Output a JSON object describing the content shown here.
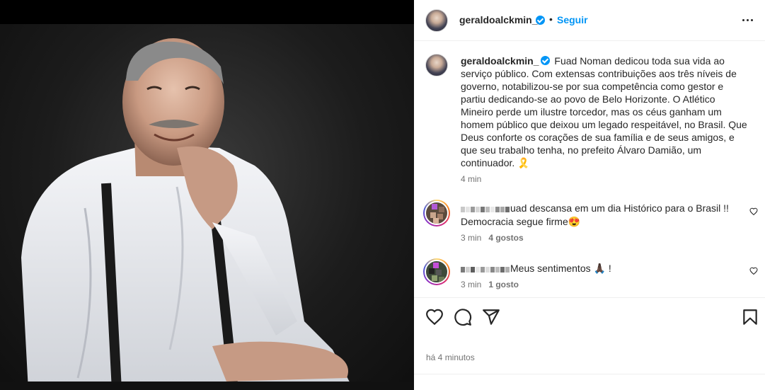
{
  "post": {
    "username": "geraldoalckmin_",
    "follow_label": "Seguir",
    "separator": "•",
    "caption": "Fuad Noman dedicou toda sua vida ao serviço público. Com extensas contribuições aos três níveis de governo, notabilizou-se por sua competência como gestor e partiu dedicando-se ao povo de Belo Horizonte. O Atlético Mineiro perde um ilustre torcedor, mas os céus ganham um homem público que deixou um legado respeitável, no Brasil. Que Deus conforte os corações de sua família e de seus amigos, e que seu trabalho tenha, no prefeito Álvaro Damião, um continuador. 🎗️",
    "caption_time": "4 min",
    "footer_time": "há 4 minutos"
  },
  "comments": [
    {
      "text": "uad descansa em um dia Histórico para o Brasil !! Democracia segue firme😍",
      "time": "3 min",
      "likes": "4 gostos"
    },
    {
      "text": "Meus sentimentos 🙏🏿 !",
      "time": "3 min",
      "likes": "1 gosto"
    }
  ],
  "icons": {
    "verified": "verified-badge-icon",
    "more": "more-options-icon",
    "like": "heart-icon",
    "comment": "comment-icon",
    "share": "send-icon",
    "save": "bookmark-icon"
  },
  "colors": {
    "accent": "#0095f6",
    "text": "#262626",
    "muted": "#737373",
    "divider": "#efefef"
  }
}
